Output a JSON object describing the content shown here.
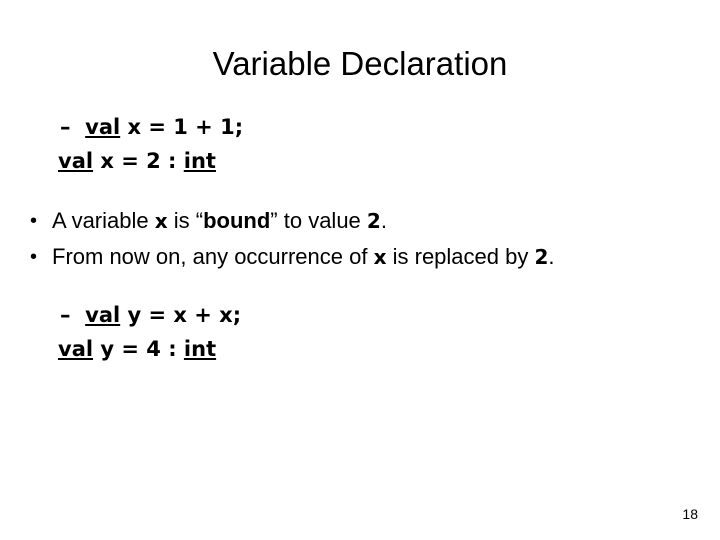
{
  "slide": {
    "title": "Variable Declaration",
    "page_number": "18",
    "code_blocks": [
      {
        "marker": "–",
        "line1_parts": {
          "keyword": "val",
          "rest": " x = 1 + 1;"
        },
        "line2_parts": {
          "keyword": "val",
          "middle": " x = 2 : ",
          "type_keyword": "int"
        }
      },
      {
        "marker": "–",
        "line1_parts": {
          "keyword": "val",
          "rest": " y = x + x;"
        },
        "line2_parts": {
          "keyword": "val",
          "middle": " y = 4 : ",
          "type_keyword": "int"
        }
      }
    ],
    "bullets": [
      {
        "marker": "•",
        "text_1": "A variable ",
        "code_1": "x",
        "text_2": " is “",
        "bold_1": "bound",
        "text_3": "” to value ",
        "code_2": "2",
        "text_4": "."
      },
      {
        "marker": "•",
        "text_1": "From now on, any occurrence of ",
        "code_1": "x",
        "text_2": " is replaced by ",
        "code_2": "2",
        "text_3": "."
      }
    ]
  }
}
